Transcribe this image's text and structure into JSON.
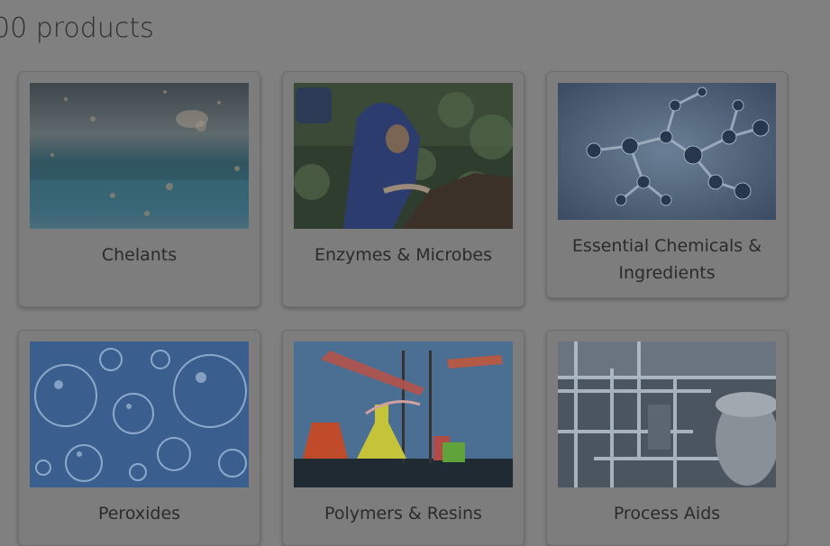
{
  "results": {
    "count_text": "00 products"
  },
  "products": [
    {
      "label": "Chelants",
      "image_icon": "water-droplets-image"
    },
    {
      "label": "Enzymes & Microbes",
      "image_icon": "hiker-forest-image"
    },
    {
      "label": "Essential Chemicals & Ingredients",
      "image_icon": "molecule-structure-image"
    },
    {
      "label": "Peroxides",
      "image_icon": "bubbles-image"
    },
    {
      "label": "Polymers & Resins",
      "image_icon": "lab-glassware-image"
    },
    {
      "label": "Process Aids",
      "image_icon": "industrial-pipes-image"
    }
  ],
  "colors": {
    "page_bg": "#808080",
    "card_bg": "#7d7d7d",
    "text": "#2b2b2b"
  }
}
